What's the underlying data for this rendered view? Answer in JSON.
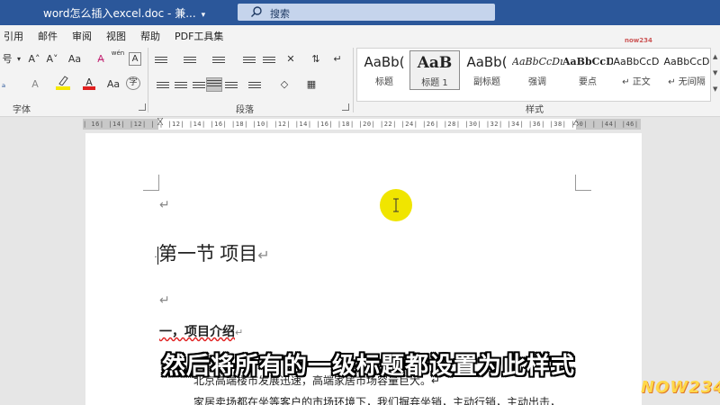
{
  "titlebar": {
    "doc_title": "word怎么插入excel.doc  -  兼...",
    "dropdown": "▾",
    "search_placeholder": "搜索"
  },
  "menu": [
    "引用",
    "邮件",
    "审阅",
    "视图",
    "帮助",
    "PDF工具集"
  ],
  "ribbon": {
    "font": {
      "label": "字体",
      "size_fragment": "号",
      "row1": [
        "A˄",
        "A˅",
        "Aa",
        "A̶",
        "wén",
        "A"
      ],
      "row2": [
        "A",
        "A",
        "A",
        "Aa",
        "A",
        "字"
      ]
    },
    "paragraph": {
      "label": "段落"
    },
    "styles": {
      "label": "样式",
      "tiles": [
        {
          "sample": "AaBb(",
          "name": "标题"
        },
        {
          "sample": "AaB",
          "name": "标题 1"
        },
        {
          "sample": "AaBb(",
          "name": "副标题"
        },
        {
          "sample": "AaBbCcDı",
          "name": "强调"
        },
        {
          "sample": "AaBbCcD",
          "name": "要点"
        },
        {
          "sample": "AaBbCcD",
          "name": "↵ 正文"
        },
        {
          "sample": "AaBbCcD",
          "name": "↵ 无间隔"
        }
      ]
    }
  },
  "ruler": {
    "text": "|  16|  |14|  |12|  |  |  |12|  |14|  |16|  |18|  |10|  |12|  |14|  |16|  |18|  |20|  |22|  |24|  |26|  |28|  |30|  |32|  |34|  |36|  |38|  |40|  |  |44|  |46|  |48|"
  },
  "document": {
    "para_mark": "↵",
    "heading": "第一节   项目",
    "subheading": "一，项目介绍",
    "line1": "北京高端楼市发展迅速，高端家居市场容量巨大。↵",
    "line2": "家居卖场都在坐等客户的市场环境下，我们摒弃坐销，主动行销，主动出击，"
  },
  "caption": "然后将所有的一级标题都设置为此样式",
  "watermark": "NOW234",
  "mini_logo": "now234"
}
